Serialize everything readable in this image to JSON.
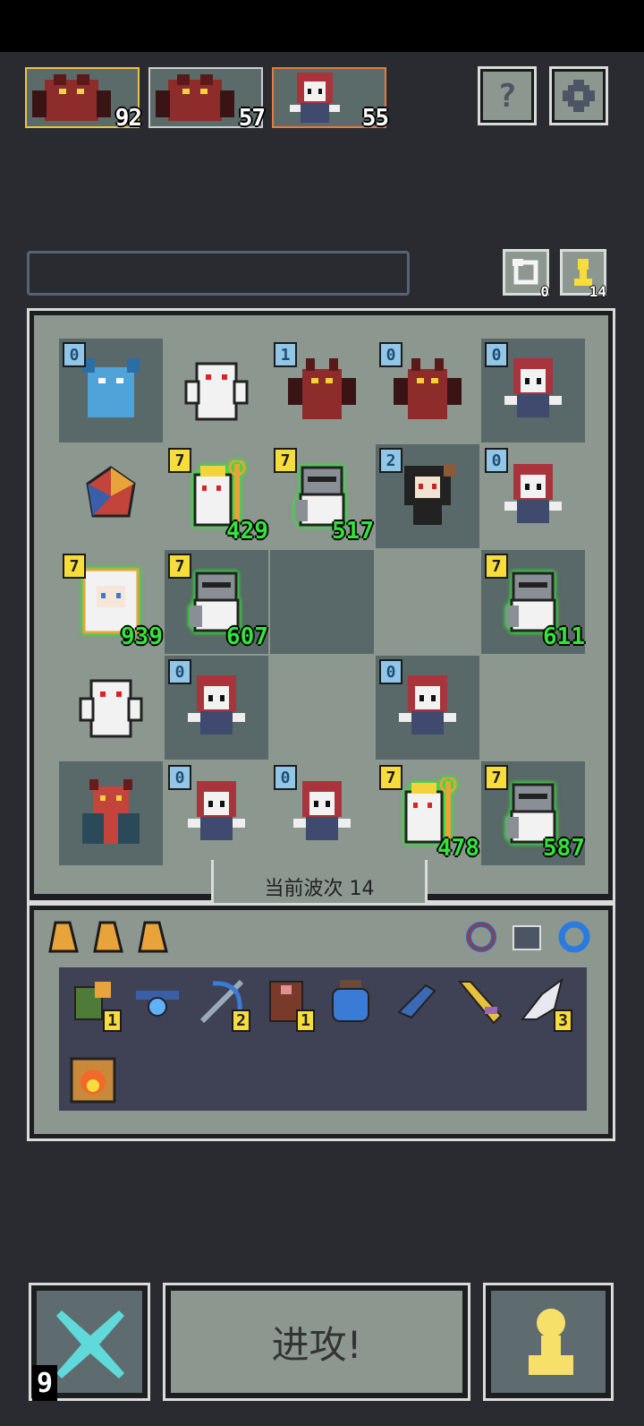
{
  "enemies": [
    {
      "name": "red-dragon",
      "value": "92",
      "border": "#f0c040"
    },
    {
      "name": "red-dragon",
      "value": "57",
      "border": "#c8c8c8"
    },
    {
      "name": "red-hair-girl",
      "value": "55",
      "border": "#e47c3a"
    }
  ],
  "buttons": {
    "help": "?",
    "settings": "gear"
  },
  "resources": {
    "restore_count": "0",
    "pawn_count": "14"
  },
  "board": {
    "rows": [
      [
        {
          "unit": "blue-demon",
          "level": "0"
        },
        {
          "unit": "white-yeti",
          "level": ""
        },
        {
          "unit": "red-dragon",
          "level": "1"
        },
        {
          "unit": "red-dragon",
          "level": "0"
        },
        {
          "unit": "red-hair-girl",
          "level": "0"
        }
      ],
      [
        {
          "unit": "gem",
          "level": ""
        },
        {
          "unit": "white-mage",
          "level": "7",
          "power": "429"
        },
        {
          "unit": "knight",
          "level": "7",
          "power": "517"
        },
        {
          "unit": "dark-girl",
          "level": "2"
        },
        {
          "unit": "red-hair-girl",
          "level": "0"
        }
      ],
      [
        {
          "unit": "white-hair-girl",
          "level": "7",
          "power": "939"
        },
        {
          "unit": "knight",
          "level": "7",
          "power": "607"
        },
        {
          "unit": "",
          "level": ""
        },
        {
          "unit": "",
          "level": ""
        },
        {
          "unit": "knight",
          "level": "7",
          "power": "611"
        }
      ],
      [
        {
          "unit": "white-yeti",
          "level": ""
        },
        {
          "unit": "red-hair-girl",
          "level": "0"
        },
        {
          "unit": "",
          "level": ""
        },
        {
          "unit": "red-hair-girl",
          "level": "0"
        },
        {
          "unit": "",
          "level": ""
        }
      ],
      [
        {
          "unit": "red-demon-lord",
          "level": ""
        },
        {
          "unit": "red-hair-girl",
          "level": "0"
        },
        {
          "unit": "red-hair-girl",
          "level": "0"
        },
        {
          "unit": "white-mage",
          "level": "7",
          "power": "478"
        },
        {
          "unit": "knight",
          "level": "7",
          "power": "587"
        }
      ]
    ]
  },
  "wave_label": "当前波次 14",
  "inventory": {
    "items": [
      {
        "icon": "green-bag-icon",
        "qty": "1"
      },
      {
        "icon": "blue-amulet-icon",
        "qty": ""
      },
      {
        "icon": "crossbow-icon",
        "qty": "2"
      },
      {
        "icon": "brown-cloak-icon",
        "qty": "1"
      },
      {
        "icon": "blue-potion-icon",
        "qty": ""
      },
      {
        "icon": "blue-gauntlet-icon",
        "qty": ""
      },
      {
        "icon": "golden-dagger-icon",
        "qty": ""
      },
      {
        "icon": "silver-horn-icon",
        "qty": "3"
      },
      {
        "icon": "fire-scroll-icon",
        "qty": ""
      }
    ]
  },
  "attack_label": "进攻!",
  "gold": "9"
}
